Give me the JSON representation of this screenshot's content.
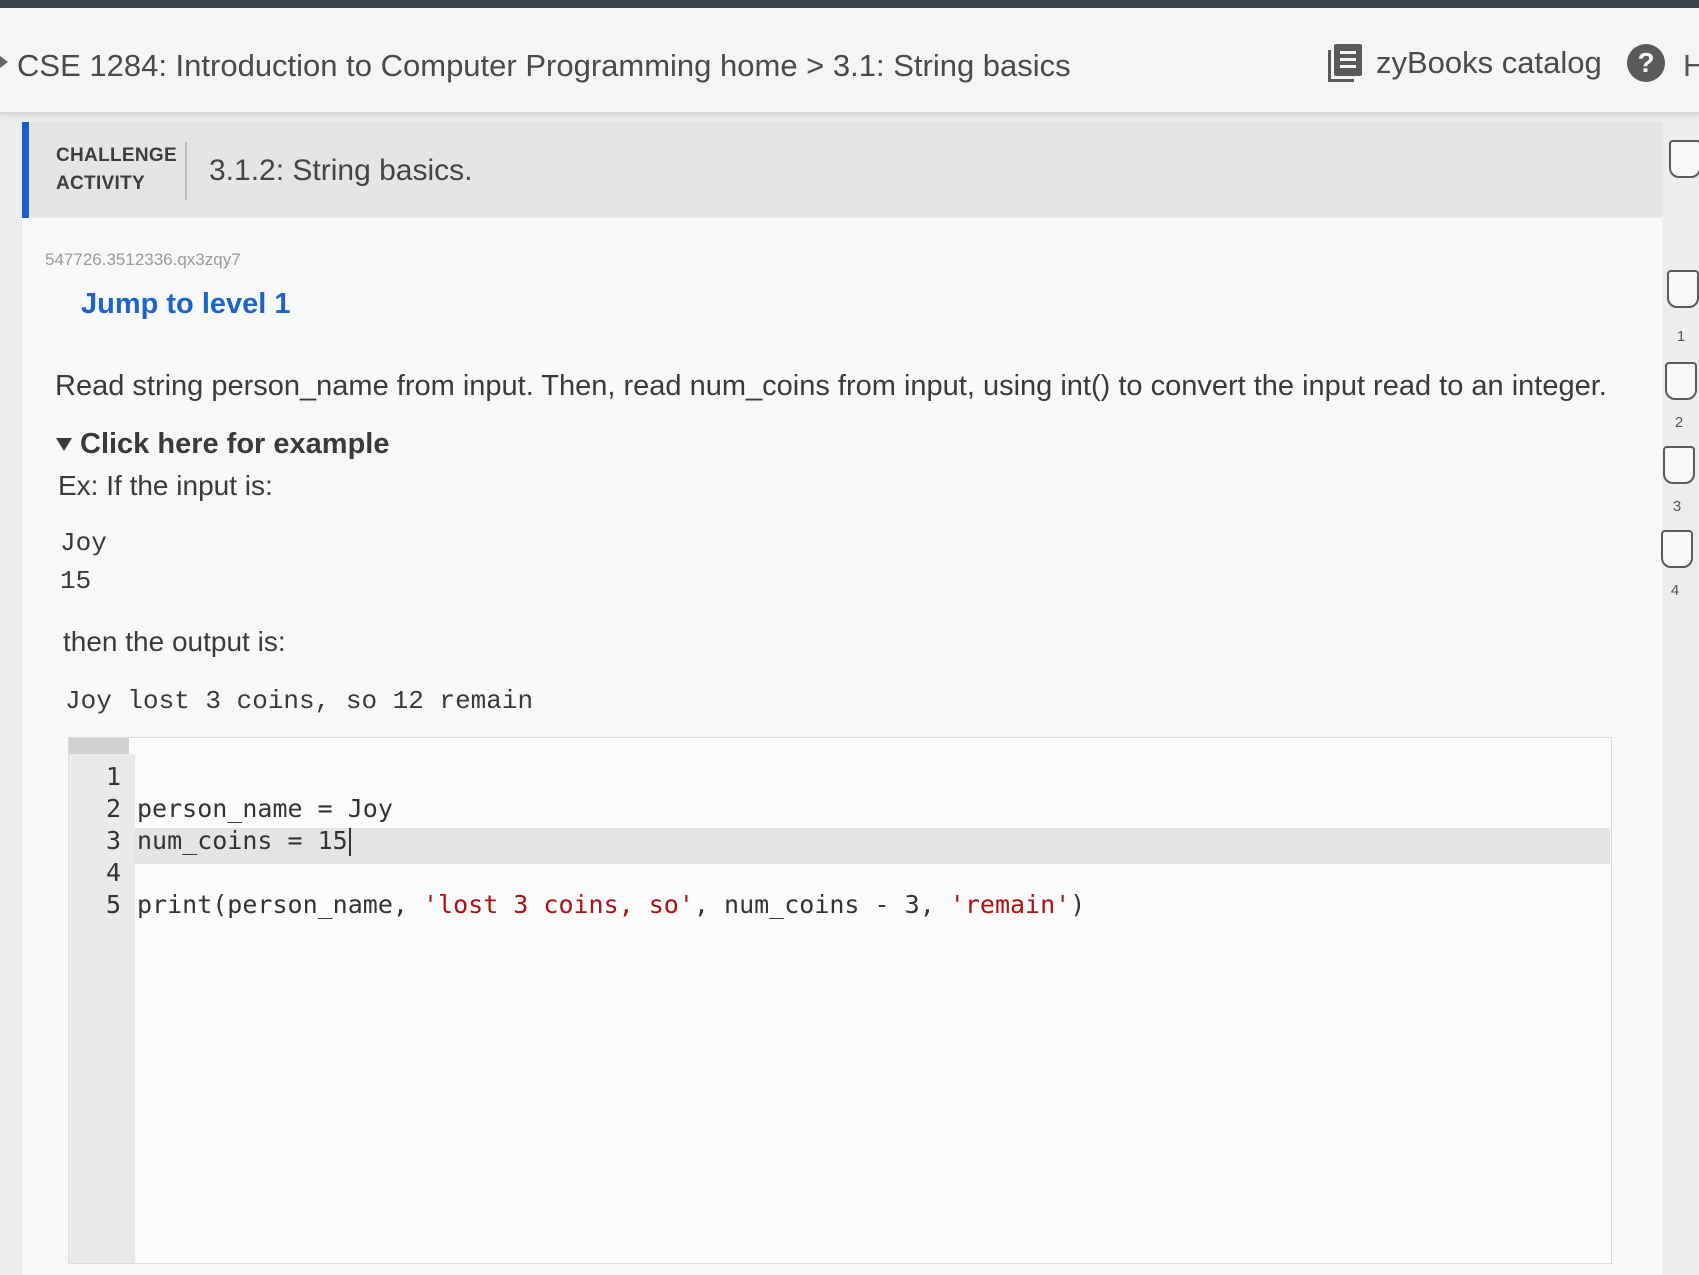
{
  "header": {
    "breadcrumb": "CSE 1284: Introduction to Computer Programming home > 3.1: String basics",
    "catalog_label": "zyBooks catalog",
    "help_label": "?",
    "cut_label": "H"
  },
  "activity": {
    "type_line1": "CHALLENGE",
    "type_line2": "ACTIVITY",
    "title": "3.1.2: String basics.",
    "id": "547726.3512336.qx3zqy7",
    "jump_link": "Jump to level 1",
    "instructions": "Read string person_name from input. Then, read num_coins from input, using int() to convert the input read to an integer.",
    "example_toggle": "Click here for example",
    "example_intro": "Ex: If the input is:",
    "example_input": [
      "Joy",
      "15"
    ],
    "output_intro": "then the output is:",
    "example_output": "Joy lost 3 coins, so 12 remain"
  },
  "editor": {
    "line_numbers": [
      "1",
      "2",
      "3",
      "4",
      "5"
    ],
    "lines": {
      "l1": "",
      "l2": "person_name = Joy",
      "l3": "num_coins = 15",
      "l4": "",
      "l5_prefix": "print(person_name, ",
      "l5_str1": "'lost 3 coins, so'",
      "l5_mid": ", num_coins - 3, ",
      "l5_str2": "'remain'",
      "l5_suffix": ")"
    }
  },
  "levels": [
    "1",
    "2",
    "3",
    "4"
  ]
}
